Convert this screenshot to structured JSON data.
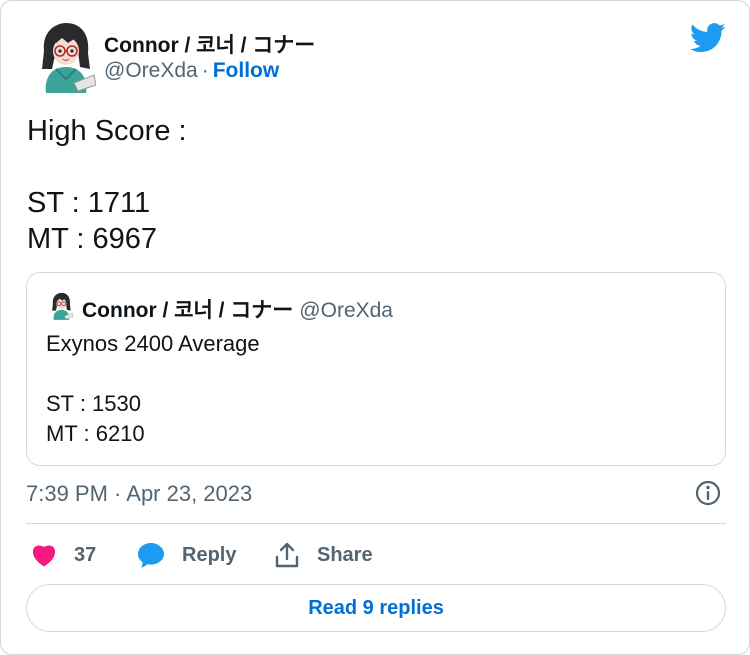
{
  "author": {
    "name": "Connor / 코너 / コナー",
    "handle": "@OreXda",
    "separator": "·",
    "follow_label": "Follow"
  },
  "tweet": {
    "text": "High Score :\n\nST : 1711\nMT : 6967"
  },
  "quoted_tweet": {
    "name": "Connor / 코너 / コナー",
    "handle": "@OreXda",
    "text": "Exynos 2400 Average\n\nST : 1530\nMT : 6210"
  },
  "timestamp": "7:39 PM · Apr 23, 2023",
  "actions": {
    "like_count": "37",
    "reply_label": "Reply",
    "share_label": "Share"
  },
  "read_replies_label": "Read 9 replies",
  "colors": {
    "link": "#006fd6",
    "like": "#f91880",
    "reply_icon": "#1d9bf0",
    "muted": "#536471",
    "border": "#cfd9de"
  },
  "icons": [
    "twitter-bird-icon",
    "info-icon",
    "heart-icon",
    "comment-icon",
    "share-icon"
  ]
}
